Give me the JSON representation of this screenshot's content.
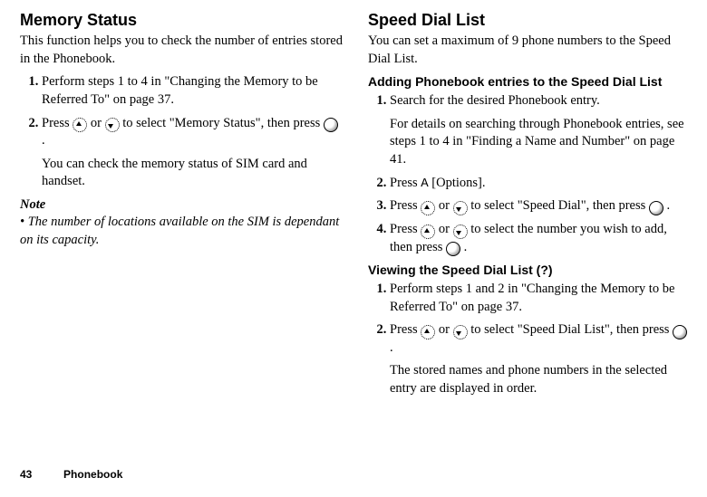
{
  "left": {
    "heading": "Memory Status",
    "lead": "This function helps you to check the number of entries stored in the Phonebook.",
    "step1": "Perform steps 1 to 4 in \"Changing the Memory to be Referred To\" on page 37.",
    "step2_a": "Press ",
    "step2_b": " or ",
    "step2_c": " to select \"Memory Status\", then press ",
    "step2_d": ".",
    "step2_after": "You can check the memory status of SIM card and handset.",
    "note_label": "Note",
    "note_body": "The number of locations available on the SIM is dependant on its capacity."
  },
  "right": {
    "heading": "Speed Dial List",
    "lead": "You can set a maximum of 9 phone numbers to the Speed Dial List.",
    "sub1": "Adding Phonebook entries to the Speed Dial List",
    "s1_step1": "Search for the desired Phonebook entry.",
    "s1_step1_after": "For details on searching through Phonebook entries, see steps 1 to 4 in \"Finding a Name and Number\" on page 41.",
    "s1_step2_a": "Press ",
    "softkey": "A",
    "s1_step2_b": " [Options].",
    "s1_step3_a": "Press ",
    "s1_step3_b": " or ",
    "s1_step3_c": " to select \"Speed Dial\", then press ",
    "s1_step3_d": ".",
    "s1_step4_a": "Press ",
    "s1_step4_b": " or ",
    "s1_step4_c": " to select the number you wish to add, then press ",
    "s1_step4_d": ".",
    "sub2": "Viewing the Speed Dial List (?)",
    "s2_step1": "Perform steps 1 and 2 in \"Changing the Memory to be Referred To\" on page 37.",
    "s2_step2_a": "Press ",
    "s2_step2_b": " or ",
    "s2_step2_c": " to select \"Speed Dial List\", then press ",
    "s2_step2_d": ".",
    "s2_after": "The stored names and phone numbers in the selected entry are displayed in order."
  },
  "footer": {
    "page": "43",
    "section": "Phonebook"
  }
}
